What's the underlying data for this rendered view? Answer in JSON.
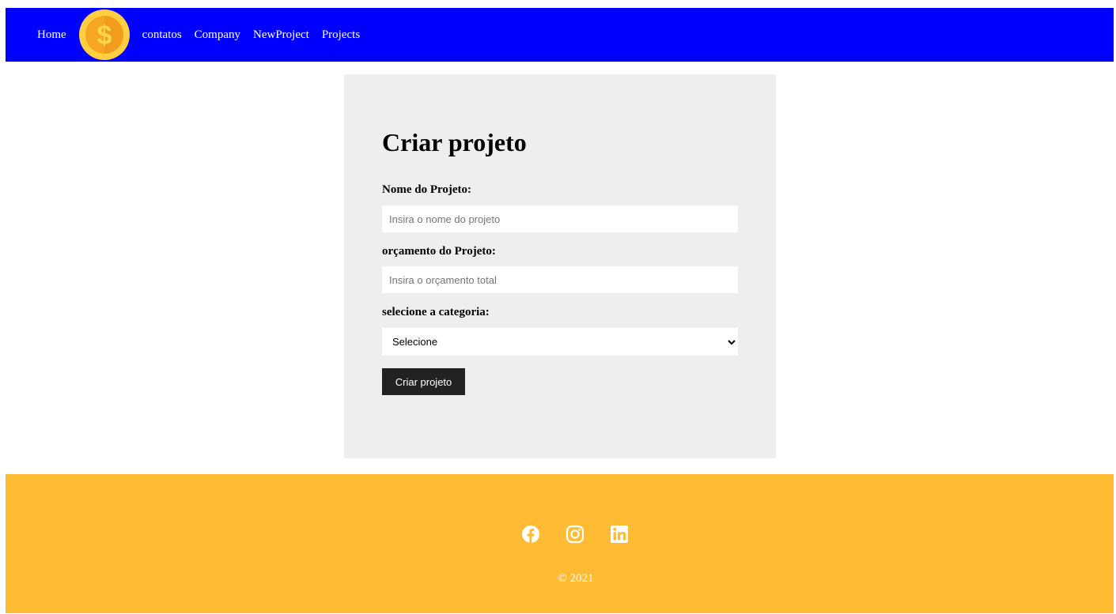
{
  "navbar": {
    "home_label": "Home",
    "logo_icon": "dollar-coin-icon",
    "links": [
      "contatos",
      "Company",
      "NewProject",
      "Projects"
    ]
  },
  "form": {
    "title": "Criar projeto",
    "name_label": "Nome do Projeto:",
    "name_placeholder": "Insira o nome do projeto",
    "budget_label": "orçamento do Projeto:",
    "budget_placeholder": "Insira o orçamento total",
    "category_label": "selecione a categoria:",
    "category_selected": "Selecione",
    "submit_label": "Criar projeto"
  },
  "footer": {
    "social_icons": [
      "facebook-icon",
      "instagram-icon",
      "linkedin-icon"
    ],
    "copyright": "© 2021"
  },
  "colors": {
    "navbar_bg": "#0000ff",
    "card_bg": "#eeeeee",
    "button_bg": "#222222",
    "footer_bg": "#ffbb33"
  }
}
